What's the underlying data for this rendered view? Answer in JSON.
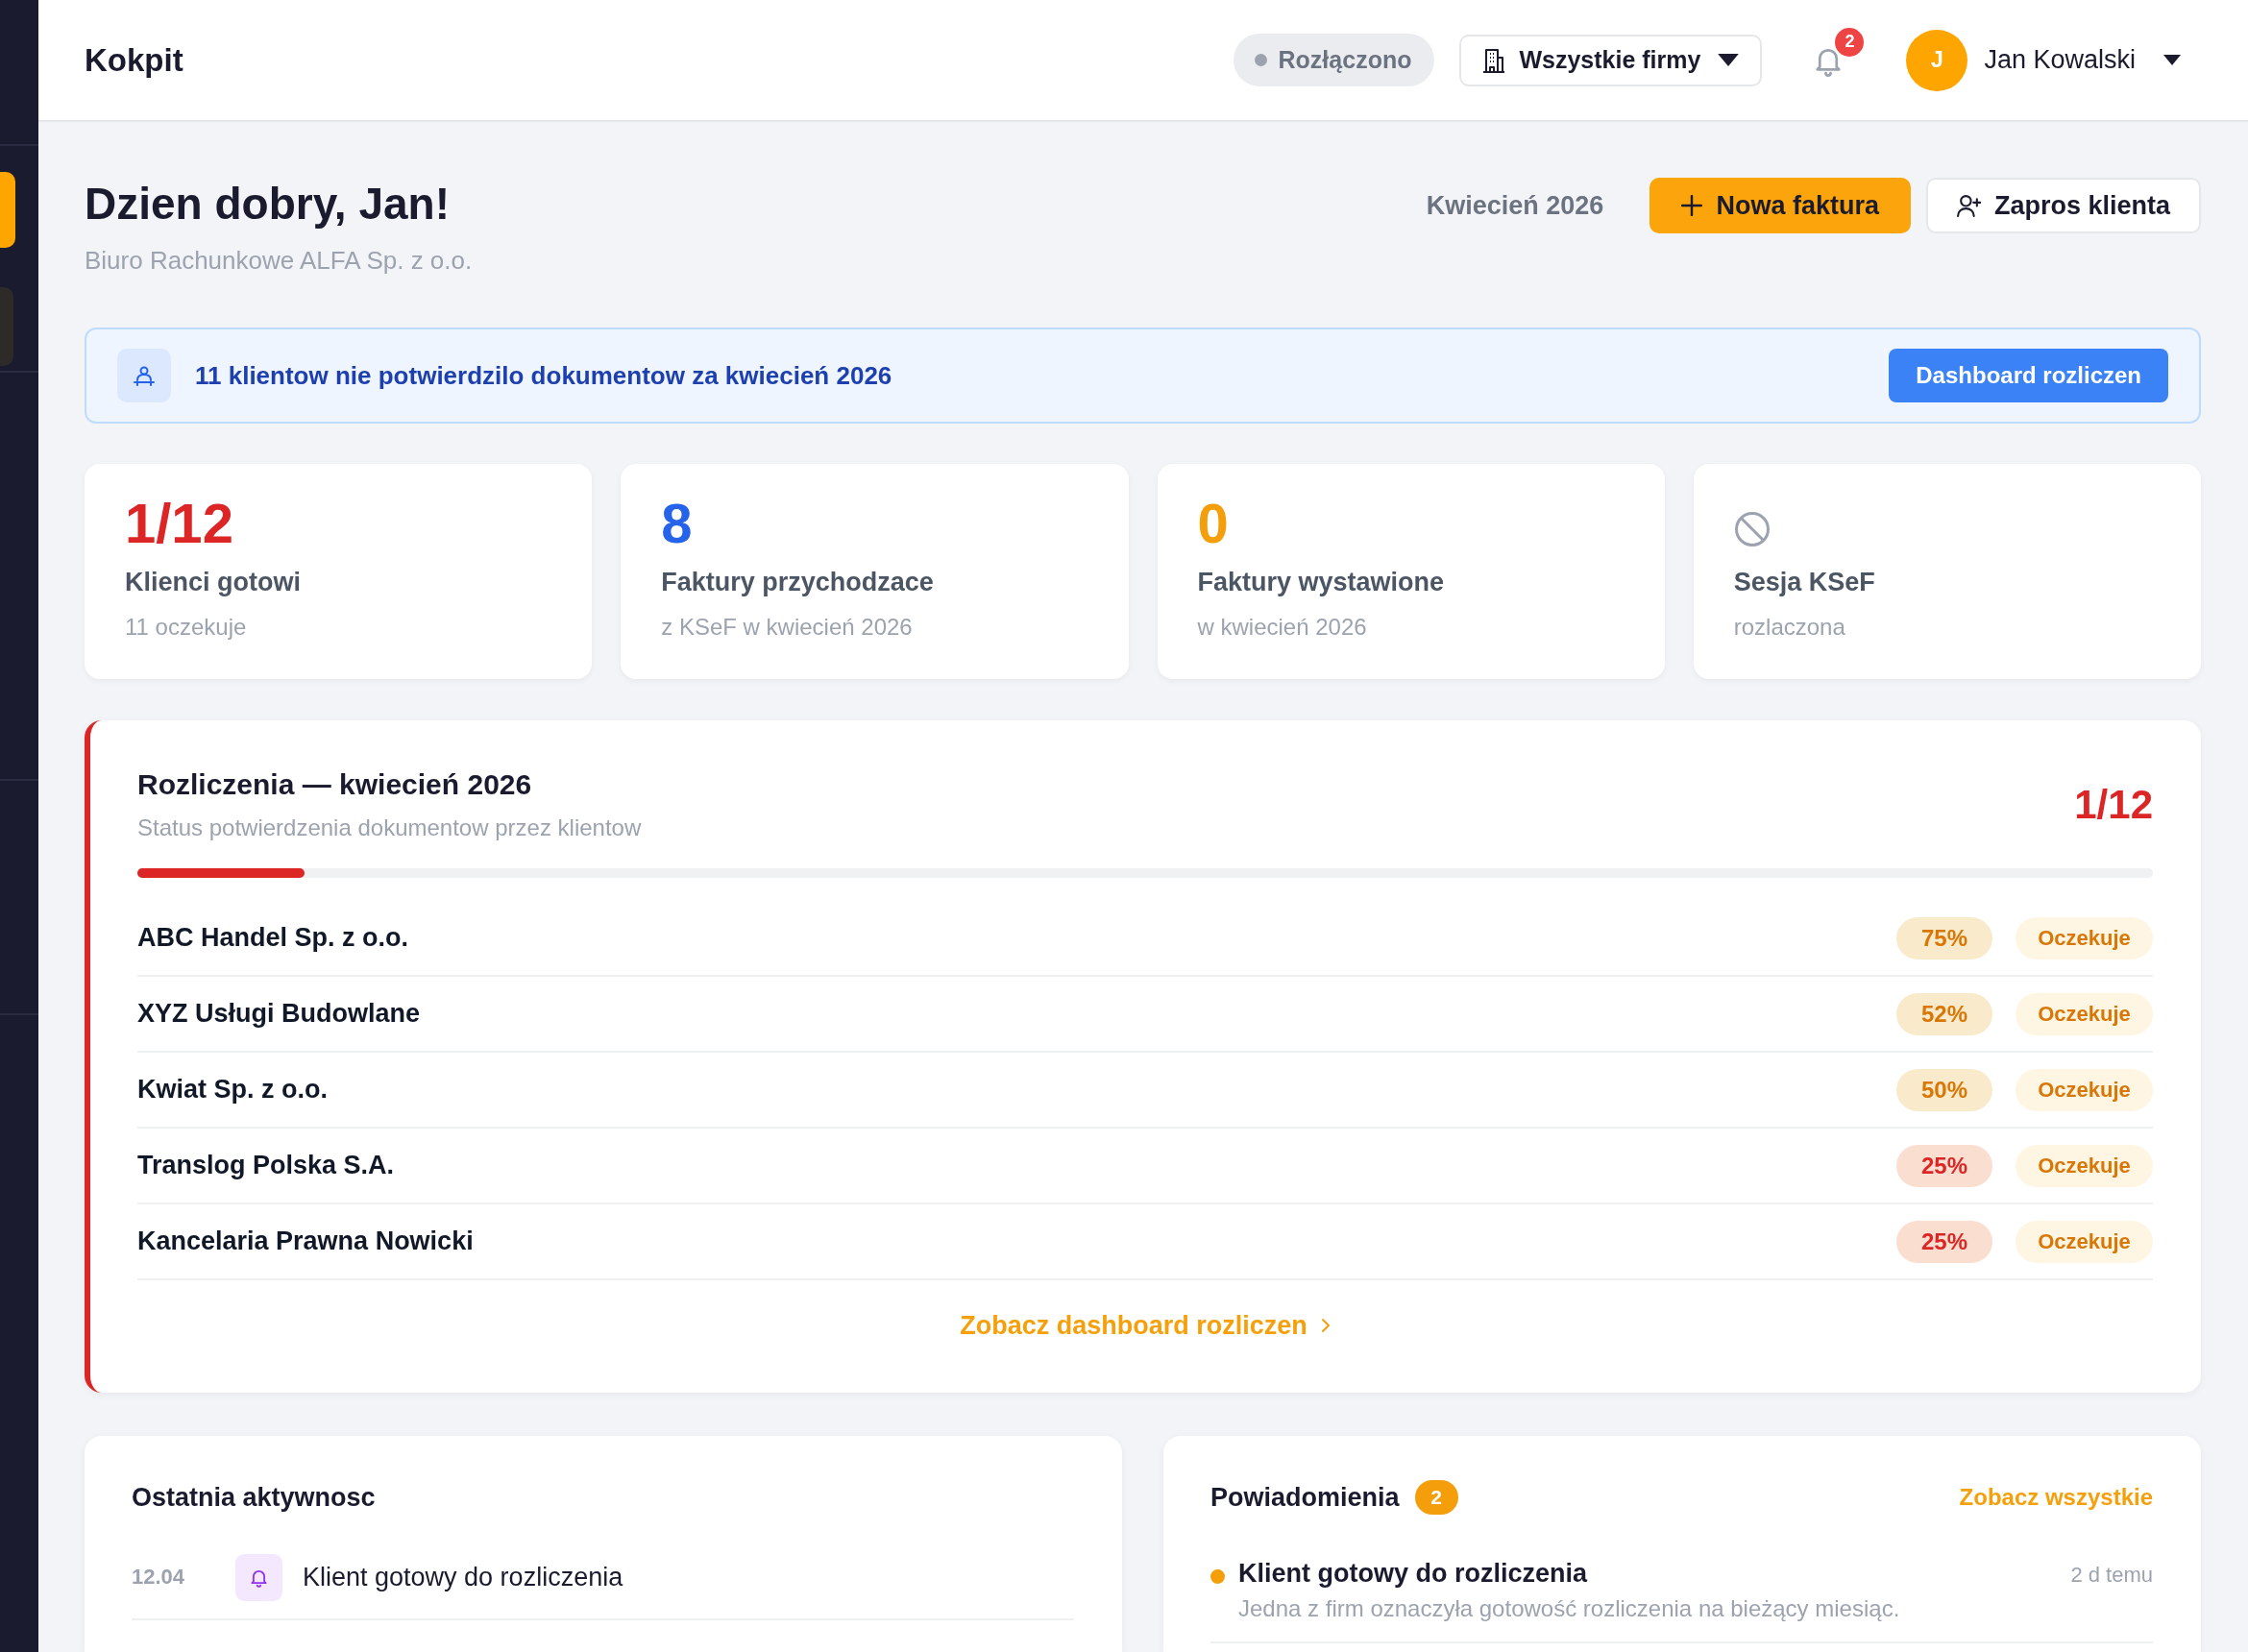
{
  "sidebar": {
    "items": [
      {
        "selected": true
      },
      {
        "selected": false
      }
    ]
  },
  "header": {
    "title": "Kokpit",
    "connection": {
      "label": "Rozłączono",
      "connected": false
    },
    "company_select": {
      "label": "Wszystkie firmy"
    },
    "notification_count": "2",
    "user": {
      "initial": "J",
      "name": "Jan Kowalski"
    }
  },
  "greeting": {
    "title": "Dzien dobry, Jan!",
    "subtitle": "Biuro Rachunkowe ALFA Sp. z o.o.",
    "period": "Kwiecień 2026",
    "new_invoice_button": "Nowa faktura",
    "invite_button": "Zapros klienta"
  },
  "alert": {
    "text": "11 klientow nie potwierdzilo dokumentow za kwiecień 2026",
    "button": "Dashboard rozliczen"
  },
  "stats": [
    {
      "kind": "number",
      "value": "1/12",
      "color": "#dc2626",
      "label": "Klienci gotowi",
      "note": "11 oczekuje"
    },
    {
      "kind": "number",
      "value": "8",
      "color": "#2563eb",
      "label": "Faktury przychodzace",
      "note": "z KSeF w kwiecień 2026"
    },
    {
      "kind": "number",
      "value": "0",
      "color": "#f59e0b",
      "label": "Faktury wystawione",
      "note": "w kwiecień 2026"
    },
    {
      "kind": "icon",
      "label": "Sesja KSeF",
      "note": "rozlaczona"
    }
  ],
  "settlements": {
    "title": "Rozliczenia — kwiecień 2026",
    "subtitle": "Status potwierdzenia dokumentow przez klientow",
    "count": "1/12",
    "level": 0.083,
    "rows": [
      {
        "name": "ABC Handel Sp. z o.o.",
        "percent": "75%",
        "color": "#d97706",
        "status": "Oczekuje"
      },
      {
        "name": "XYZ Usługi Budowlane",
        "percent": "52%",
        "color": "#d97706",
        "status": "Oczekuje"
      },
      {
        "name": "Kwiat Sp. z o.o.",
        "percent": "50%",
        "color": "#d97706",
        "status": "Oczekuje"
      },
      {
        "name": "Translog Polska S.A.",
        "percent": "25%",
        "color": "#dc2626",
        "status": "Oczekuje"
      },
      {
        "name": "Kancelaria Prawna Nowicki",
        "percent": "25%",
        "color": "#dc2626",
        "status": "Oczekuje"
      }
    ],
    "link": "Zobacz dashboard rozliczen"
  },
  "activity": {
    "title": "Ostatnia aktywnosc",
    "items": [
      {
        "date": "12.04",
        "kind": "bell",
        "text": "Klient gotowy do rozliczenia"
      }
    ]
  },
  "notifications": {
    "title": "Powiadomienia",
    "count": "2",
    "link": "Zobacz wszystkie",
    "items": [
      {
        "unread": true,
        "title": "Klient gotowy do rozliczenia",
        "time": "2 d temu",
        "text": "Jedna z firm oznaczyła gotowość rozliczenia na bieżący miesiąc."
      }
    ]
  }
}
